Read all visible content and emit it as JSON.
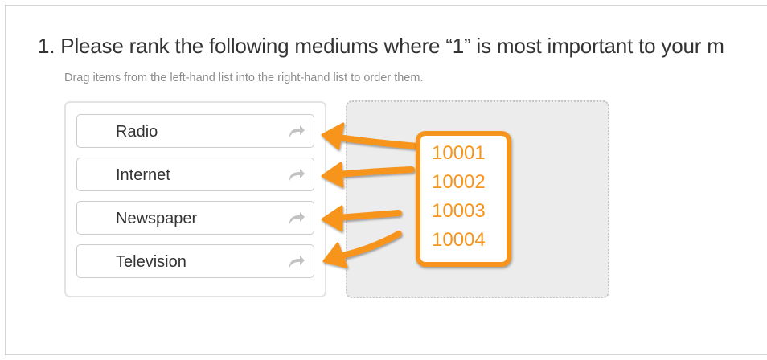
{
  "question": {
    "title": "1. Please rank the following mediums where “1” is most important to your m",
    "instructions": "Drag items from the left-hand list into the right-hand list to order them."
  },
  "ranking": {
    "items": [
      {
        "label": "Radio",
        "icon": "move-arrow-icon"
      },
      {
        "label": "Internet",
        "icon": "move-arrow-icon"
      },
      {
        "label": "Newspaper",
        "icon": "move-arrow-icon"
      },
      {
        "label": "Television",
        "icon": "move-arrow-icon"
      }
    ],
    "target_state": "empty"
  },
  "annotation": {
    "codes": [
      "10001",
      "10002",
      "10003",
      "10004"
    ],
    "color": "#f7941d"
  }
}
